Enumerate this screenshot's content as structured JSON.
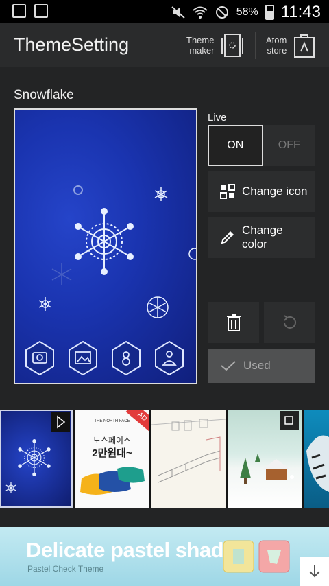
{
  "status_bar": {
    "battery_percent": "58%",
    "time": "11:43",
    "icons": [
      "gallery-icon",
      "sim-icon",
      "mute-icon",
      "wifi-icon",
      "do-not-disturb-icon",
      "battery-icon"
    ]
  },
  "header": {
    "title": "ThemeSetting",
    "theme_maker_line1": "Theme",
    "theme_maker_line2": "maker",
    "atom_store_line1": "Atom",
    "atom_store_line2": "store"
  },
  "theme": {
    "name": "Snowflake"
  },
  "controls": {
    "live_label": "Live",
    "live_on": "ON",
    "live_off": "OFF",
    "live_state": "ON",
    "change_icon": "Change icon",
    "change_color_line1": "Change",
    "change_color_line2": "color",
    "used": "Used"
  },
  "strip": {
    "ad_badge": "AD",
    "ad_brand": "THE NORTH FACE",
    "ad_line1": "노스페이스",
    "ad_line2": "2만원대~"
  },
  "banner": {
    "title": "Delicate pastel shades",
    "subtitle": "Pastel Check Theme"
  },
  "colors": {
    "background": "#232425",
    "button": "#2c2d2e",
    "preview_blue": "#1a34b0",
    "banner": "#b3e1ec"
  }
}
